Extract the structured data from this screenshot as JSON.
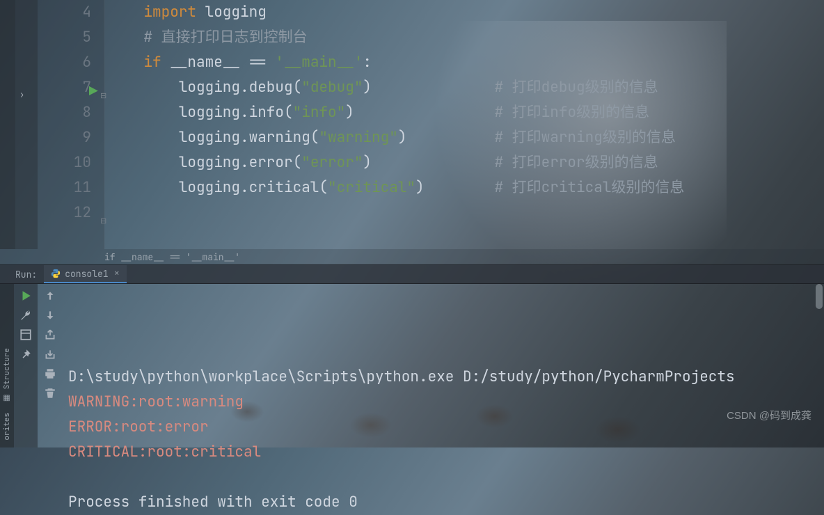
{
  "editor": {
    "lines": [
      {
        "n": 4,
        "indent": 0,
        "segments": []
      },
      {
        "n": 5,
        "indent": 1,
        "segments": [
          {
            "t": "import ",
            "c": "kw"
          },
          {
            "t": "logging",
            "c": "ident"
          }
        ]
      },
      {
        "n": 6,
        "indent": 1,
        "segments": [
          {
            "t": "# 直接打印日志到控制台",
            "c": "cmt"
          }
        ]
      },
      {
        "n": 7,
        "indent": 1,
        "run_mark": true,
        "fold": "⊟",
        "segments": [
          {
            "t": "if ",
            "c": "kw"
          },
          {
            "t": "__name__ == ",
            "c": "op"
          },
          {
            "t": "'__main__'",
            "c": "str"
          },
          {
            "t": ":",
            "c": "op"
          }
        ]
      },
      {
        "n": 8,
        "indent": 2,
        "segments": [
          {
            "t": "logging.debug(",
            "c": "ident"
          },
          {
            "t": "\"debug\"",
            "c": "str"
          },
          {
            "t": ")",
            "c": "ident"
          }
        ],
        "comment": "# 打印debug级别的信息"
      },
      {
        "n": 9,
        "indent": 2,
        "segments": [
          {
            "t": "logging.info(",
            "c": "ident"
          },
          {
            "t": "\"info\"",
            "c": "str"
          },
          {
            "t": ")",
            "c": "ident"
          }
        ],
        "comment": "# 打印info级别的信息"
      },
      {
        "n": 10,
        "indent": 2,
        "segments": [
          {
            "t": "logging.warning(",
            "c": "ident"
          },
          {
            "t": "\"warning\"",
            "c": "str"
          },
          {
            "t": ")",
            "c": "ident"
          }
        ],
        "comment": "# 打印warning级别的信息"
      },
      {
        "n": 11,
        "indent": 2,
        "segments": [
          {
            "t": "logging.error(",
            "c": "ident"
          },
          {
            "t": "\"error\"",
            "c": "str"
          },
          {
            "t": ")",
            "c": "ident"
          }
        ],
        "comment": "# 打印error级别的信息"
      },
      {
        "n": 12,
        "indent": 2,
        "fold": "⊟",
        "segments": [
          {
            "t": "logging.critical(",
            "c": "ident"
          },
          {
            "t": "\"critical\"",
            "c": "str"
          },
          {
            "t": ")",
            "c": "ident"
          }
        ],
        "comment": "# 打印critical级别的信息"
      }
    ],
    "breadcrumb": "if __name__ == '__main__'"
  },
  "run": {
    "label": "Run:",
    "tab_name": "console1",
    "output": [
      {
        "text": "D:\\study\\python\\workplace\\Scripts\\python.exe D:/study/python/PycharmProjects",
        "cls": ""
      },
      {
        "text": "WARNING:root:warning",
        "cls": "err"
      },
      {
        "text": "ERROR:root:error",
        "cls": "err"
      },
      {
        "text": "CRITICAL:root:critical",
        "cls": "err"
      },
      {
        "text": "",
        "cls": ""
      },
      {
        "text": "Process finished with exit code 0",
        "cls": ""
      }
    ]
  },
  "sidetabs": {
    "structure": "Structure",
    "favorites": "orites"
  },
  "watermark": "CSDN @码到成龚"
}
